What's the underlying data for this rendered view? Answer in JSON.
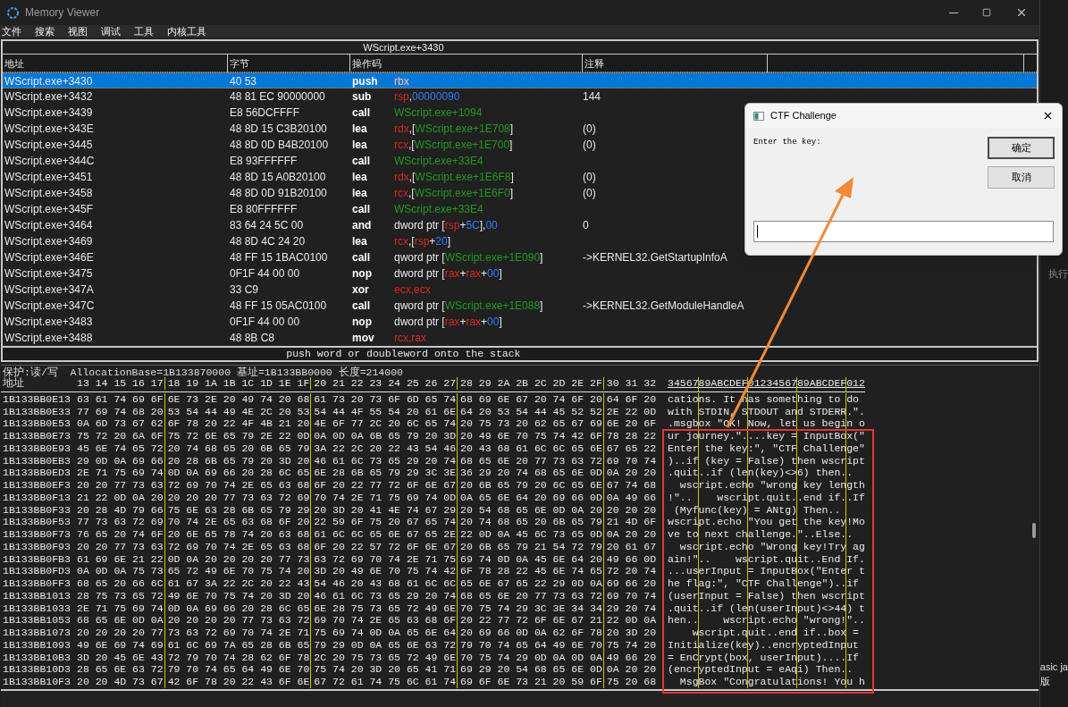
{
  "window": {
    "title": "Memory Viewer"
  },
  "menu": [
    "文件",
    "搜索",
    "视图",
    "调试",
    "工具",
    "内核工具"
  ],
  "disassembly": {
    "title": "WScript.exe+3430",
    "columns": [
      "地址",
      "字节",
      "操作码",
      "注释"
    ],
    "rows": [
      {
        "address": "WScript.exe+3430",
        "bytes": "40 53",
        "opcode": "push",
        "operand": [
          {
            "kind": "reg",
            "text": "rbx"
          }
        ],
        "selected": true
      },
      {
        "address": "WScript.exe+3432",
        "bytes": "48 81 EC 90000000",
        "opcode": "sub",
        "operand": [
          {
            "kind": "reg",
            "text": "rsp"
          },
          {
            "kind": "plain",
            "text": ","
          },
          {
            "kind": "num",
            "text": "00000090"
          }
        ],
        "comment": "144",
        "selected": false
      },
      {
        "address": "WScript.exe+3439",
        "bytes": "E8 56DCFFFF",
        "opcode": "call",
        "operand": [
          {
            "kind": "sym",
            "text": "WScript.exe+1094"
          }
        ],
        "selected": false
      },
      {
        "address": "WScript.exe+343E",
        "bytes": "48 8D 15 C3B20100",
        "opcode": "lea",
        "operand": [
          {
            "kind": "reg",
            "text": "rdx"
          },
          {
            "kind": "plain",
            "text": ",["
          },
          {
            "kind": "sym",
            "text": "WScript.exe+1E708"
          },
          {
            "kind": "plain",
            "text": "]"
          }
        ],
        "comment": "(0)",
        "selected": false
      },
      {
        "address": "WScript.exe+3445",
        "bytes": "48 8D 0D B4B20100",
        "opcode": "lea",
        "operand": [
          {
            "kind": "reg",
            "text": "rcx"
          },
          {
            "kind": "plain",
            "text": ",["
          },
          {
            "kind": "sym",
            "text": "WScript.exe+1E700"
          },
          {
            "kind": "plain",
            "text": "]"
          }
        ],
        "comment": "(0)",
        "selected": false
      },
      {
        "address": "WScript.exe+344C",
        "bytes": "E8 93FFFFFF",
        "opcode": "call",
        "operand": [
          {
            "kind": "sym",
            "text": "WScript.exe+33E4"
          }
        ],
        "selected": false
      },
      {
        "address": "WScript.exe+3451",
        "bytes": "48 8D 15 A0B20100",
        "opcode": "lea",
        "operand": [
          {
            "kind": "reg",
            "text": "rdx"
          },
          {
            "kind": "plain",
            "text": ",["
          },
          {
            "kind": "sym",
            "text": "WScript.exe+1E6F8"
          },
          {
            "kind": "plain",
            "text": "]"
          }
        ],
        "comment": "(0)",
        "selected": false
      },
      {
        "address": "WScript.exe+3458",
        "bytes": "48 8D 0D 91B20100",
        "opcode": "lea",
        "operand": [
          {
            "kind": "reg",
            "text": "rcx"
          },
          {
            "kind": "plain",
            "text": ",["
          },
          {
            "kind": "sym",
            "text": "WScript.exe+1E6F0"
          },
          {
            "kind": "plain",
            "text": "]"
          }
        ],
        "comment": "(0)",
        "selected": false
      },
      {
        "address": "WScript.exe+345F",
        "bytes": "E8 80FFFFFF",
        "opcode": "call",
        "operand": [
          {
            "kind": "sym",
            "text": "WScript.exe+33E4"
          }
        ],
        "selected": false
      },
      {
        "address": "WScript.exe+3464",
        "bytes": "83 64 24 5C 00",
        "opcode": "and",
        "operand": [
          {
            "kind": "plain",
            "text": "dword ptr ["
          },
          {
            "kind": "reg",
            "text": "rsp"
          },
          {
            "kind": "plain",
            "text": "+"
          },
          {
            "kind": "num",
            "text": "5C"
          },
          {
            "kind": "plain",
            "text": "],"
          },
          {
            "kind": "num",
            "text": "00"
          }
        ],
        "comment": "0",
        "selected": false
      },
      {
        "address": "WScript.exe+3469",
        "bytes": "48 8D 4C 24 20",
        "opcode": "lea",
        "operand": [
          {
            "kind": "reg",
            "text": "rcx"
          },
          {
            "kind": "plain",
            "text": ",["
          },
          {
            "kind": "reg",
            "text": "rsp"
          },
          {
            "kind": "plain",
            "text": "+"
          },
          {
            "kind": "num",
            "text": "20"
          },
          {
            "kind": "plain",
            "text": "]"
          }
        ],
        "selected": false
      },
      {
        "address": "WScript.exe+346E",
        "bytes": "48 FF 15 1BAC0100",
        "opcode": "call",
        "operand": [
          {
            "kind": "plain",
            "text": "qword ptr ["
          },
          {
            "kind": "sym",
            "text": "WScript.exe+1E090"
          },
          {
            "kind": "plain",
            "text": "]"
          }
        ],
        "comment": "->KERNEL32.GetStartupInfoA",
        "selected": false
      },
      {
        "address": "WScript.exe+3475",
        "bytes": "0F1F 44 00 00",
        "opcode": "nop",
        "operand": [
          {
            "kind": "plain",
            "text": "dword ptr ["
          },
          {
            "kind": "reg",
            "text": "rax"
          },
          {
            "kind": "plain",
            "text": "+"
          },
          {
            "kind": "reg",
            "text": "rax"
          },
          {
            "kind": "plain",
            "text": "+"
          },
          {
            "kind": "num",
            "text": "00"
          },
          {
            "kind": "plain",
            "text": "]"
          }
        ],
        "selected": false
      },
      {
        "address": "WScript.exe+347A",
        "bytes": "33 C9",
        "opcode": "xor",
        "operand": [
          {
            "kind": "reg",
            "text": "ecx"
          },
          {
            "kind": "reg",
            "text": ","
          },
          {
            "kind": "reg",
            "text": "ecx"
          }
        ],
        "selected": false
      },
      {
        "address": "WScript.exe+347C",
        "bytes": "48 FF 15 05AC0100",
        "opcode": "call",
        "operand": [
          {
            "kind": "plain",
            "text": "qword ptr ["
          },
          {
            "kind": "sym",
            "text": "WScript.exe+1E088"
          },
          {
            "kind": "plain",
            "text": "]"
          }
        ],
        "comment": "->KERNEL32.GetModuleHandleA",
        "selected": false
      },
      {
        "address": "WScript.exe+3483",
        "bytes": "0F1F 44 00 00",
        "opcode": "nop",
        "operand": [
          {
            "kind": "plain",
            "text": "dword ptr ["
          },
          {
            "kind": "reg",
            "text": "rax"
          },
          {
            "kind": "plain",
            "text": "+"
          },
          {
            "kind": "reg",
            "text": "rax"
          },
          {
            "kind": "plain",
            "text": "+"
          },
          {
            "kind": "num",
            "text": "00"
          },
          {
            "kind": "plain",
            "text": "]"
          }
        ],
        "selected": false
      },
      {
        "address": "WScript.exe+3488",
        "bytes": "48 8B C8",
        "opcode": "mov",
        "operand": [
          {
            "kind": "reg",
            "text": "rcx"
          },
          {
            "kind": "reg",
            "text": ","
          },
          {
            "kind": "reg",
            "text": "rax"
          }
        ],
        "selected": false
      }
    ],
    "status": "push word or doubleword onto the stack"
  },
  "hex_view": {
    "protection": "保护:读/写",
    "allocation_base": "AllocationBase=1B133870000",
    "base": "基址=1B133BB0000",
    "length": "长度=214000",
    "address_header": "地址",
    "column_groups": [
      "13 14 15 16 17",
      "18 19 1A 1B 1C 1D 1E 1F",
      "20 21 22 23 24 25 26 27",
      "28 29 2A 2B 2C 2D 2E 2F",
      "30 31 32"
    ],
    "ascii_header": "3456789ABCDEF0123456789ABCDEF012",
    "rows": [
      {
        "address": "1B133BB0E13",
        "hex": [
          "63 61 74 69 6F",
          "6E 73 2E 20 49 74 20 68",
          "61 73 20 73 6F 6D 65 74",
          "68 69 6E 67 20 74 6F 20",
          "64 6F 20"
        ],
        "ascii": "cations. It has something to do "
      },
      {
        "address": "1B133BB0E33",
        "hex": [
          "77 69 74 68 20",
          "53 54 44 49 4E 2C 20 53",
          "54 44 4F 55 54 20 61 6E",
          "64 20 53 54 44 45 52 52",
          "2E 22 0D"
        ],
        "ascii": "with STDIN, STDOUT and STDERR.\"."
      },
      {
        "address": "1B133BB0E53",
        "hex": [
          "0A 6D 73 67 62",
          "6F 78 20 22 4F 4B 21 20",
          "4E 6F 77 2C 20 6C 65 74",
          "20 75 73 20 62 65 67 69",
          "6E 20 6F"
        ],
        "ascii": ".msgbox \"OK! Now, let us begin o"
      },
      {
        "address": "1B133BB0E73",
        "hex": [
          "75 72 20 6A 6F",
          "75 72 6E 65 79 2E 22 0D",
          "0A 0D 0A 6B 65 79 20 3D",
          "20 49 6E 70 75 74 42 6F",
          "78 28 22"
        ],
        "ascii": "ur journey.\"....key = InputBox(\""
      },
      {
        "address": "1B133BB0E93",
        "hex": [
          "45 6E 74 65 72",
          "20 74 68 65 20 6B 65 79",
          "3A 22 2C 20 22 43 54 46",
          "20 43 68 61 6C 6C 65 6E",
          "67 65 22"
        ],
        "ascii": "Enter the key:\", \"CTF Challenge\""
      },
      {
        "address": "1B133BB0EB3",
        "hex": [
          "29 0D 0A 69 66",
          "20 28 6B 65 79 20 3D 20",
          "46 61 6C 73 65 29 20 74",
          "68 65 6E 20 77 73 63 72",
          "69 70 74"
        ],
        "ascii": ")..if (key = False) then wscript"
      },
      {
        "address": "1B133BB0ED3",
        "hex": [
          "2E 71 75 69 74",
          "0D 0A 69 66 20 28 6C 65",
          "6E 28 6B 65 79 29 3C 3E",
          "36 29 20 74 68 65 6E 0D",
          "0A 20 20"
        ],
        "ascii": ".quit..if (len(key)<>6) then..  "
      },
      {
        "address": "1B133BB0EF3",
        "hex": [
          "20 20 77 73 63",
          "72 69 70 74 2E 65 63 68",
          "6F 20 22 77 72 6F 6E 67",
          "20 6B 65 79 20 6C 65 6E",
          "67 74 68"
        ],
        "ascii": "  wscript.echo \"wrong key length"
      },
      {
        "address": "1B133BB0F13",
        "hex": [
          "21 22 0D 0A 20",
          "20 20 20 77 73 63 72 69",
          "70 74 2E 71 75 69 74 0D",
          "0A 65 6E 64 20 69 66 0D",
          "0A 49 66"
        ],
        "ascii": "!\"..    wscript.quit..end if..If"
      },
      {
        "address": "1B133BB0F33",
        "hex": [
          "20 28 4D 79 66",
          "75 6E 63 28 6B 65 79 29",
          "20 3D 20 41 4E 74 67 29",
          "20 54 68 65 6E 0D 0A 20",
          "20 20 20"
        ],
        "ascii": " (Myfunc(key) = ANtg) Then..    "
      },
      {
        "address": "1B133BB0F53",
        "hex": [
          "77 73 63 72 69",
          "70 74 2E 65 63 68 6F 20",
          "22 59 6F 75 20 67 65 74",
          "20 74 68 65 20 6B 65 79",
          "21 4D 6F"
        ],
        "ascii": "wscript.echo \"You get the key!Mo"
      },
      {
        "address": "1B133BB0F73",
        "hex": [
          "76 65 20 74 6F",
          "20 6E 65 78 74 20 63 68",
          "61 6C 6C 65 6E 67 65 2E",
          "22 0D 0A 45 6C 73 65 0D",
          "0A 20 20"
        ],
        "ascii": "ve to next challenge.\"..Else..  "
      },
      {
        "address": "1B133BB0F93",
        "hex": [
          "20 20 77 73 63",
          "72 69 70 74 2E 65 63 68",
          "6F 20 22 57 72 6F 6E 67",
          "20 6B 65 79 21 54 72 79",
          "20 61 67"
        ],
        "ascii": "  wscript.echo \"Wrong key!Try ag"
      },
      {
        "address": "1B133BB0FB3",
        "hex": [
          "61 69 6E 21 22",
          "0D 0A 20 20 20 20 77 73",
          "63 72 69 70 74 2E 71 75",
          "69 74 0D 0A 45 6E 64 20",
          "49 66 0D"
        ],
        "ascii": "ain!\"..    wscript.quit..End If."
      },
      {
        "address": "1B133BB0FD3",
        "hex": [
          "0A 0D 0A 75 73",
          "65 72 49 6E 70 75 74 20",
          "3D 20 49 6E 70 75 74 42",
          "6F 78 28 22 45 6E 74 65",
          "72 20 74"
        ],
        "ascii": "...userInput = InputBox(\"Enter t"
      },
      {
        "address": "1B133BB0FF3",
        "hex": [
          "68 65 20 66 6C",
          "61 67 3A 22 2C 20 22 43",
          "54 46 20 43 68 61 6C 6C",
          "65 6E 67 65 22 29 0D 0A",
          "69 66 20"
        ],
        "ascii": "he flag:\", \"CTF Challenge\")..if "
      },
      {
        "address": "1B133BB1013",
        "hex": [
          "28 75 73 65 72",
          "49 6E 70 75 74 20 3D 20",
          "46 61 6C 73 65 29 20 74",
          "68 65 6E 20 77 73 63 72",
          "69 70 74"
        ],
        "ascii": "(userInput = False) then wscript"
      },
      {
        "address": "1B133BB1033",
        "hex": [
          "2E 71 75 69 74",
          "0D 0A 69 66 20 28 6C 65",
          "6E 28 75 73 65 72 49 6E",
          "70 75 74 29 3C 3E 34 34",
          "29 20 74"
        ],
        "ascii": ".quit..if (len(userInput)<>44) t"
      },
      {
        "address": "1B133BB1053",
        "hex": [
          "68 65 6E 0D 0A",
          "20 20 20 20 77 73 63 72",
          "69 70 74 2E 65 63 68 6F",
          "20 22 77 72 6F 6E 67 21",
          "22 0D 0A"
        ],
        "ascii": "hen..    wscript.echo \"wrong!\".."
      },
      {
        "address": "1B133BB1073",
        "hex": [
          "20 20 20 20 77",
          "73 63 72 69 70 74 2E 71",
          "75 69 74 0D 0A 65 6E 64",
          "20 69 66 0D 0A 62 6F 78",
          "20 3D 20"
        ],
        "ascii": "    wscript.quit..end if..box = "
      },
      {
        "address": "1B133BB1093",
        "hex": [
          "49 6E 69 74 69",
          "61 6C 69 7A 65 28 6B 65",
          "79 29 0D 0A 65 6E 63 72",
          "79 70 74 65 64 49 6E 70",
          "75 74 20"
        ],
        "ascii": "Initialize(key)..encryptedInput "
      },
      {
        "address": "1B133BB10B3",
        "hex": [
          "3D 20 45 6E 43",
          "72 79 70 74 28 62 6F 78",
          "2C 20 75 73 65 72 49 6E",
          "70 75 74 29 0D 0A 0D 0A",
          "49 66 20"
        ],
        "ascii": "= EnCrypt(box, userInput)....If "
      },
      {
        "address": "1B133BB10D3",
        "hex": [
          "28 65 6E 63 72",
          "79 70 74 65 64 49 6E 70",
          "75 74 20 3D 20 65 41 71",
          "69 29 20 54 68 65 6E 0D",
          "0A 20 20"
        ],
        "ascii": "(encryptedInput = eAqi) Then..  "
      },
      {
        "address": "1B133BB10F3",
        "hex": [
          "20 20 4D 73 67",
          "42 6F 78 20 22 43 6F 6E",
          "67 72 61 74 75 6C 61 74",
          "69 6F 6E 73 21 20 59 6F",
          "75 20 68"
        ],
        "ascii": "  MsgBox \"Congratulations! You h"
      }
    ]
  },
  "dialog": {
    "title": "CTF Challenge",
    "prompt": "Enter the key:",
    "buttons": [
      "确定",
      "取消"
    ]
  },
  "background": {
    "texts": [
      "执行",
      "asic ja",
      "版"
    ]
  }
}
